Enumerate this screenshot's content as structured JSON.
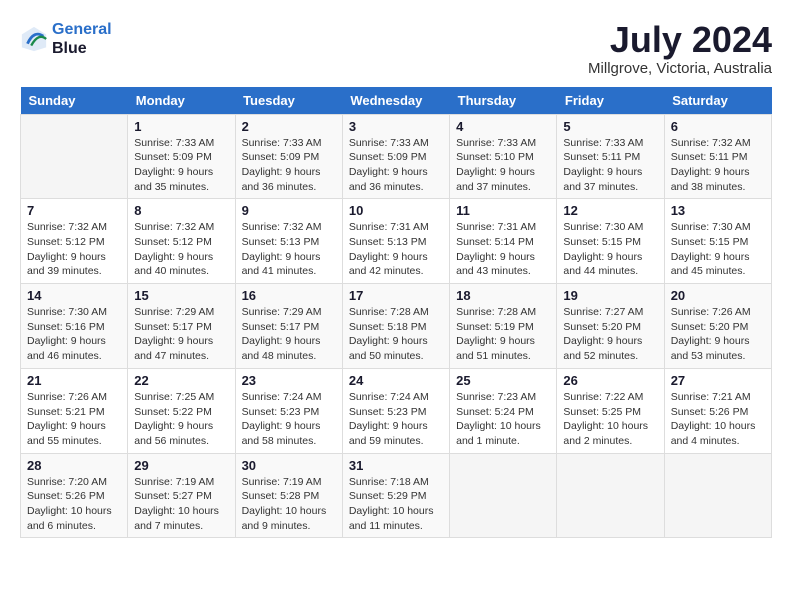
{
  "header": {
    "logo_line1": "General",
    "logo_line2": "Blue",
    "month_title": "July 2024",
    "location": "Millgrove, Victoria, Australia"
  },
  "weekdays": [
    "Sunday",
    "Monday",
    "Tuesday",
    "Wednesday",
    "Thursday",
    "Friday",
    "Saturday"
  ],
  "weeks": [
    [
      {
        "day": "",
        "info": ""
      },
      {
        "day": "1",
        "info": "Sunrise: 7:33 AM\nSunset: 5:09 PM\nDaylight: 9 hours\nand 35 minutes."
      },
      {
        "day": "2",
        "info": "Sunrise: 7:33 AM\nSunset: 5:09 PM\nDaylight: 9 hours\nand 36 minutes."
      },
      {
        "day": "3",
        "info": "Sunrise: 7:33 AM\nSunset: 5:09 PM\nDaylight: 9 hours\nand 36 minutes."
      },
      {
        "day": "4",
        "info": "Sunrise: 7:33 AM\nSunset: 5:10 PM\nDaylight: 9 hours\nand 37 minutes."
      },
      {
        "day": "5",
        "info": "Sunrise: 7:33 AM\nSunset: 5:11 PM\nDaylight: 9 hours\nand 37 minutes."
      },
      {
        "day": "6",
        "info": "Sunrise: 7:32 AM\nSunset: 5:11 PM\nDaylight: 9 hours\nand 38 minutes."
      }
    ],
    [
      {
        "day": "7",
        "info": "Sunrise: 7:32 AM\nSunset: 5:12 PM\nDaylight: 9 hours\nand 39 minutes."
      },
      {
        "day": "8",
        "info": "Sunrise: 7:32 AM\nSunset: 5:12 PM\nDaylight: 9 hours\nand 40 minutes."
      },
      {
        "day": "9",
        "info": "Sunrise: 7:32 AM\nSunset: 5:13 PM\nDaylight: 9 hours\nand 41 minutes."
      },
      {
        "day": "10",
        "info": "Sunrise: 7:31 AM\nSunset: 5:13 PM\nDaylight: 9 hours\nand 42 minutes."
      },
      {
        "day": "11",
        "info": "Sunrise: 7:31 AM\nSunset: 5:14 PM\nDaylight: 9 hours\nand 43 minutes."
      },
      {
        "day": "12",
        "info": "Sunrise: 7:30 AM\nSunset: 5:15 PM\nDaylight: 9 hours\nand 44 minutes."
      },
      {
        "day": "13",
        "info": "Sunrise: 7:30 AM\nSunset: 5:15 PM\nDaylight: 9 hours\nand 45 minutes."
      }
    ],
    [
      {
        "day": "14",
        "info": "Sunrise: 7:30 AM\nSunset: 5:16 PM\nDaylight: 9 hours\nand 46 minutes."
      },
      {
        "day": "15",
        "info": "Sunrise: 7:29 AM\nSunset: 5:17 PM\nDaylight: 9 hours\nand 47 minutes."
      },
      {
        "day": "16",
        "info": "Sunrise: 7:29 AM\nSunset: 5:17 PM\nDaylight: 9 hours\nand 48 minutes."
      },
      {
        "day": "17",
        "info": "Sunrise: 7:28 AM\nSunset: 5:18 PM\nDaylight: 9 hours\nand 50 minutes."
      },
      {
        "day": "18",
        "info": "Sunrise: 7:28 AM\nSunset: 5:19 PM\nDaylight: 9 hours\nand 51 minutes."
      },
      {
        "day": "19",
        "info": "Sunrise: 7:27 AM\nSunset: 5:20 PM\nDaylight: 9 hours\nand 52 minutes."
      },
      {
        "day": "20",
        "info": "Sunrise: 7:26 AM\nSunset: 5:20 PM\nDaylight: 9 hours\nand 53 minutes."
      }
    ],
    [
      {
        "day": "21",
        "info": "Sunrise: 7:26 AM\nSunset: 5:21 PM\nDaylight: 9 hours\nand 55 minutes."
      },
      {
        "day": "22",
        "info": "Sunrise: 7:25 AM\nSunset: 5:22 PM\nDaylight: 9 hours\nand 56 minutes."
      },
      {
        "day": "23",
        "info": "Sunrise: 7:24 AM\nSunset: 5:23 PM\nDaylight: 9 hours\nand 58 minutes."
      },
      {
        "day": "24",
        "info": "Sunrise: 7:24 AM\nSunset: 5:23 PM\nDaylight: 9 hours\nand 59 minutes."
      },
      {
        "day": "25",
        "info": "Sunrise: 7:23 AM\nSunset: 5:24 PM\nDaylight: 10 hours\nand 1 minute."
      },
      {
        "day": "26",
        "info": "Sunrise: 7:22 AM\nSunset: 5:25 PM\nDaylight: 10 hours\nand 2 minutes."
      },
      {
        "day": "27",
        "info": "Sunrise: 7:21 AM\nSunset: 5:26 PM\nDaylight: 10 hours\nand 4 minutes."
      }
    ],
    [
      {
        "day": "28",
        "info": "Sunrise: 7:20 AM\nSunset: 5:26 PM\nDaylight: 10 hours\nand 6 minutes."
      },
      {
        "day": "29",
        "info": "Sunrise: 7:19 AM\nSunset: 5:27 PM\nDaylight: 10 hours\nand 7 minutes."
      },
      {
        "day": "30",
        "info": "Sunrise: 7:19 AM\nSunset: 5:28 PM\nDaylight: 10 hours\nand 9 minutes."
      },
      {
        "day": "31",
        "info": "Sunrise: 7:18 AM\nSunset: 5:29 PM\nDaylight: 10 hours\nand 11 minutes."
      },
      {
        "day": "",
        "info": ""
      },
      {
        "day": "",
        "info": ""
      },
      {
        "day": "",
        "info": ""
      }
    ]
  ]
}
